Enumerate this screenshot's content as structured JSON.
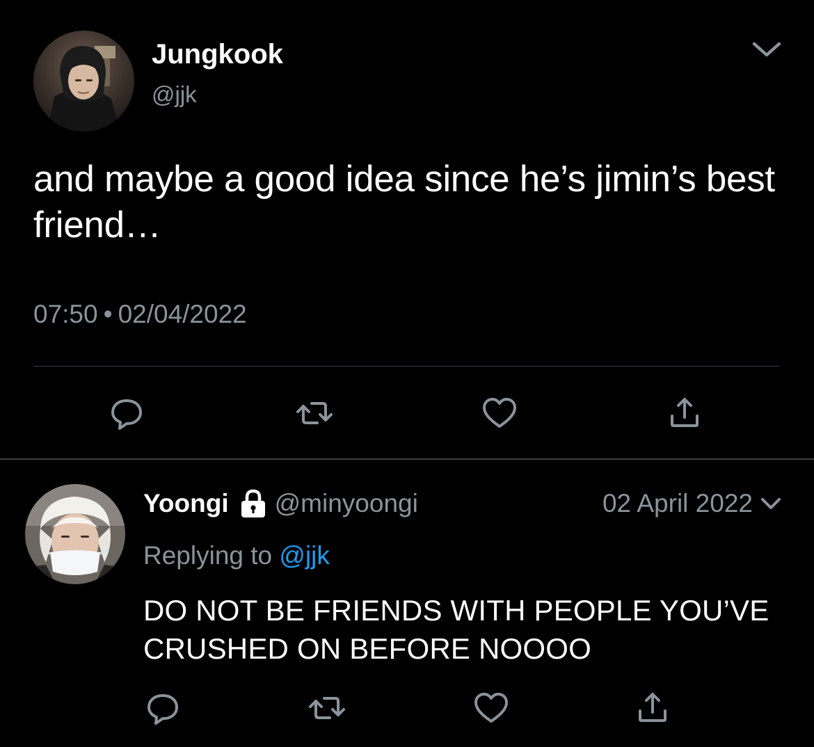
{
  "main_tweet": {
    "author_name": "Jungkook",
    "author_handle": "@jjk",
    "text": "and maybe a good idea since he’s jimin’s best friend…",
    "time": "07:50",
    "separator": "•",
    "date": "02/04/2022",
    "menu_icon": "chevron-down-icon",
    "actions": [
      "reply-icon",
      "retweet-icon",
      "like-icon",
      "share-icon"
    ]
  },
  "reply_tweet": {
    "author_name": "Yoongi",
    "protected_icon": "lock-icon",
    "author_handle": "@minyoongi",
    "date": "02 April 2022",
    "menu_icon": "chevron-down-icon",
    "replying_to_label": "Replying to",
    "replying_to_handle": "@jjk",
    "text": "DO NOT BE FRIENDS WITH PEOPLE YOU’VE CRUSHED ON BEFORE NOOOO",
    "actions": [
      "reply-icon",
      "retweet-icon",
      "like-icon",
      "share-icon"
    ]
  },
  "colors": {
    "background": "#000000",
    "primary_text": "#ffffff",
    "secondary_text": "#8b949c",
    "link": "#1d9bf0",
    "divider": "#3a3f44"
  }
}
